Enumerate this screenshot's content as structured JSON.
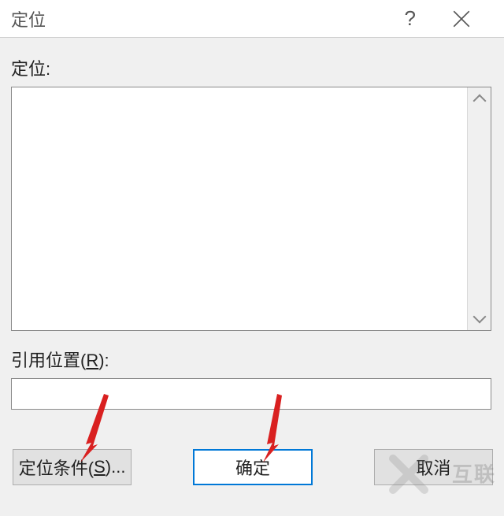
{
  "titlebar": {
    "title": "定位",
    "help": "?"
  },
  "fields": {
    "goto_label": "定位:",
    "reference_label_prefix": "引用位置(",
    "reference_label_key": "R",
    "reference_label_suffix": "):",
    "reference_value": ""
  },
  "buttons": {
    "special_prefix": "定位条件(",
    "special_key": "S",
    "special_suffix": ")...",
    "ok": "确定",
    "cancel": "取消"
  },
  "watermark": "互联"
}
